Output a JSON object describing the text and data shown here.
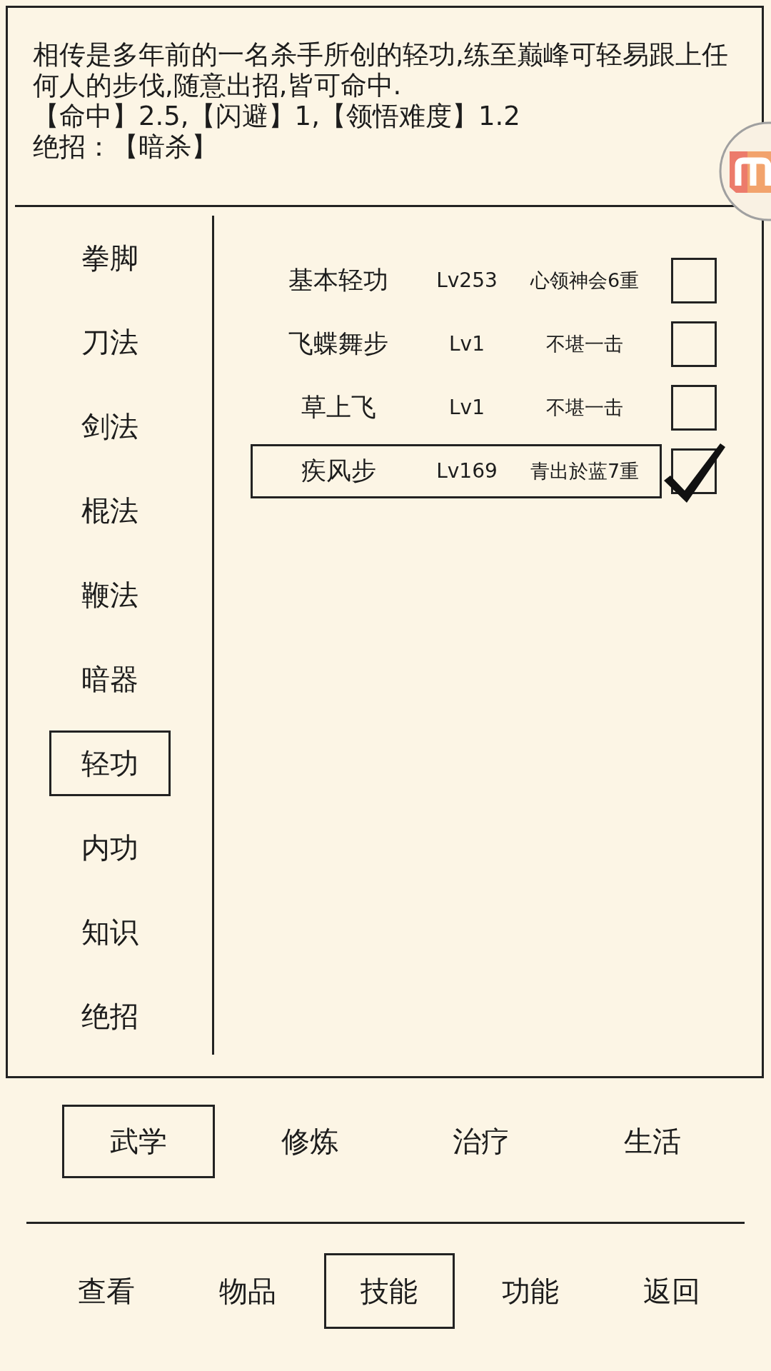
{
  "description": {
    "text": "相传是多年前的一名杀手所创的轻功,练至巅峰可轻易跟上任何人的步伐,随意出招,皆可命中.",
    "stats": "【命中】2.5,【闪避】1,【领悟难度】1.2",
    "special_move": "绝招：【暗杀】"
  },
  "categories": [
    {
      "label": "拳脚",
      "selected": false
    },
    {
      "label": "刀法",
      "selected": false
    },
    {
      "label": "剑法",
      "selected": false
    },
    {
      "label": "棍法",
      "selected": false
    },
    {
      "label": "鞭法",
      "selected": false
    },
    {
      "label": "暗器",
      "selected": false
    },
    {
      "label": "轻功",
      "selected": true
    },
    {
      "label": "内功",
      "selected": false
    },
    {
      "label": "知识",
      "selected": false
    },
    {
      "label": "绝招",
      "selected": false
    }
  ],
  "skills": [
    {
      "name": "基本轻功",
      "lv": "Lv253",
      "grade": "心领神会6重",
      "selected": false,
      "checked": false
    },
    {
      "name": "飞蝶舞步",
      "lv": "Lv1",
      "grade": "不堪一击",
      "selected": false,
      "checked": false
    },
    {
      "name": "草上飞",
      "lv": "Lv1",
      "grade": "不堪一击",
      "selected": false,
      "checked": false
    },
    {
      "name": "疾风步",
      "lv": "Lv169",
      "grade": "青出於蓝7重",
      "selected": true,
      "checked": true
    }
  ],
  "tabs": [
    {
      "label": "武学",
      "selected": true
    },
    {
      "label": "修炼",
      "selected": false
    },
    {
      "label": "治疗",
      "selected": false
    },
    {
      "label": "生活",
      "selected": false
    }
  ],
  "nav": [
    {
      "label": "查看",
      "selected": false
    },
    {
      "label": "物品",
      "selected": false
    },
    {
      "label": "技能",
      "selected": true
    },
    {
      "label": "功能",
      "selected": false
    },
    {
      "label": "返回",
      "selected": false
    }
  ]
}
